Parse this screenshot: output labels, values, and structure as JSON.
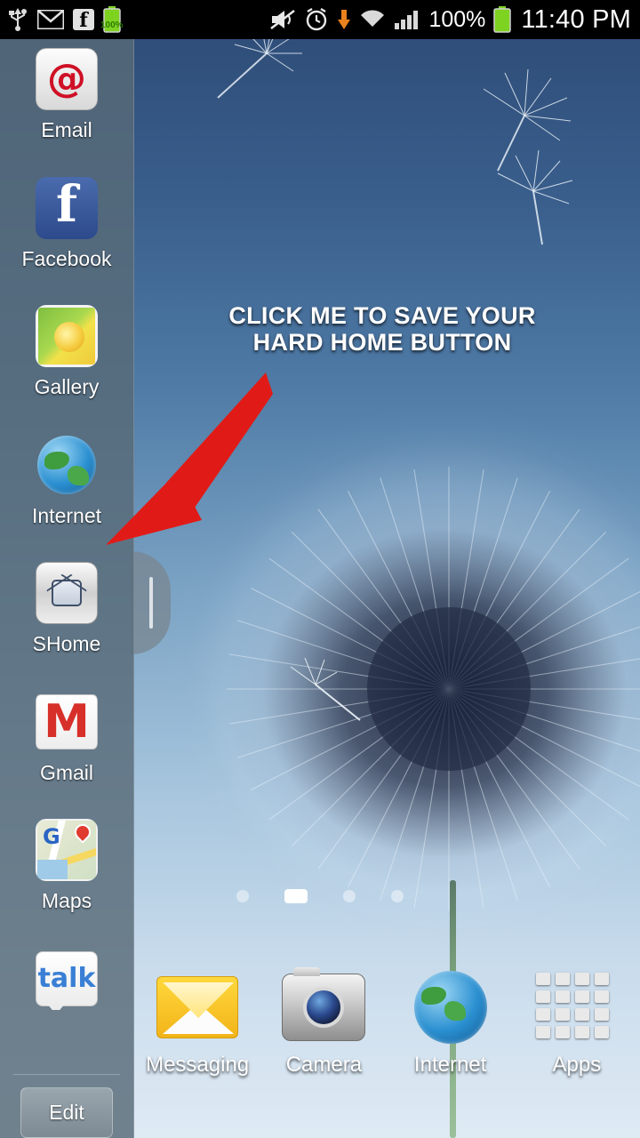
{
  "statusbar": {
    "icons_left": [
      "usb-icon",
      "gmail-icon",
      "facebook-icon",
      "battery-charge-icon"
    ],
    "battery_small_label": "100%",
    "icons_right": [
      "mute-vibrate-icon",
      "alarm-icon",
      "download-icon",
      "wifi-icon",
      "signal-icon"
    ],
    "battery_percent": "100%",
    "time": "11:40 PM"
  },
  "app_drawer": {
    "items": [
      {
        "label": "Email",
        "icon": "email-at-icon"
      },
      {
        "label": "Facebook",
        "icon": "facebook-icon"
      },
      {
        "label": "Gallery",
        "icon": "gallery-flower-icon"
      },
      {
        "label": "Internet",
        "icon": "internet-globe-icon"
      },
      {
        "label": "SHome",
        "icon": "shome-softkey-icon"
      },
      {
        "label": "Gmail",
        "icon": "gmail-m-icon"
      },
      {
        "label": "Maps",
        "icon": "maps-pin-icon"
      },
      {
        "label": "Talk",
        "icon": "talk-bubble-icon"
      }
    ],
    "edit_label": "Edit",
    "handle": "drawer-handle"
  },
  "overlay": {
    "annotation_line1": "CLICK ME TO SAVE YOUR",
    "annotation_line2": "HARD HOME BUTTON",
    "arrow_color": "#e01b17"
  },
  "homescreen": {
    "page_dots": {
      "count": 4,
      "active_index": 1
    }
  },
  "dock": {
    "items": [
      {
        "label": "Messaging",
        "icon": "messaging-envelope-icon"
      },
      {
        "label": "Camera",
        "icon": "camera-icon"
      },
      {
        "label": "Internet",
        "icon": "internet-globe-icon"
      },
      {
        "label": "Apps",
        "icon": "apps-grid-icon"
      }
    ]
  },
  "colors": {
    "status_bar_bg": "#000000",
    "drawer_bg": "#586a78",
    "accent_red": "#e01b17",
    "wallpaper_top": "#2d4a75",
    "wallpaper_bottom": "#dfeaf4"
  }
}
